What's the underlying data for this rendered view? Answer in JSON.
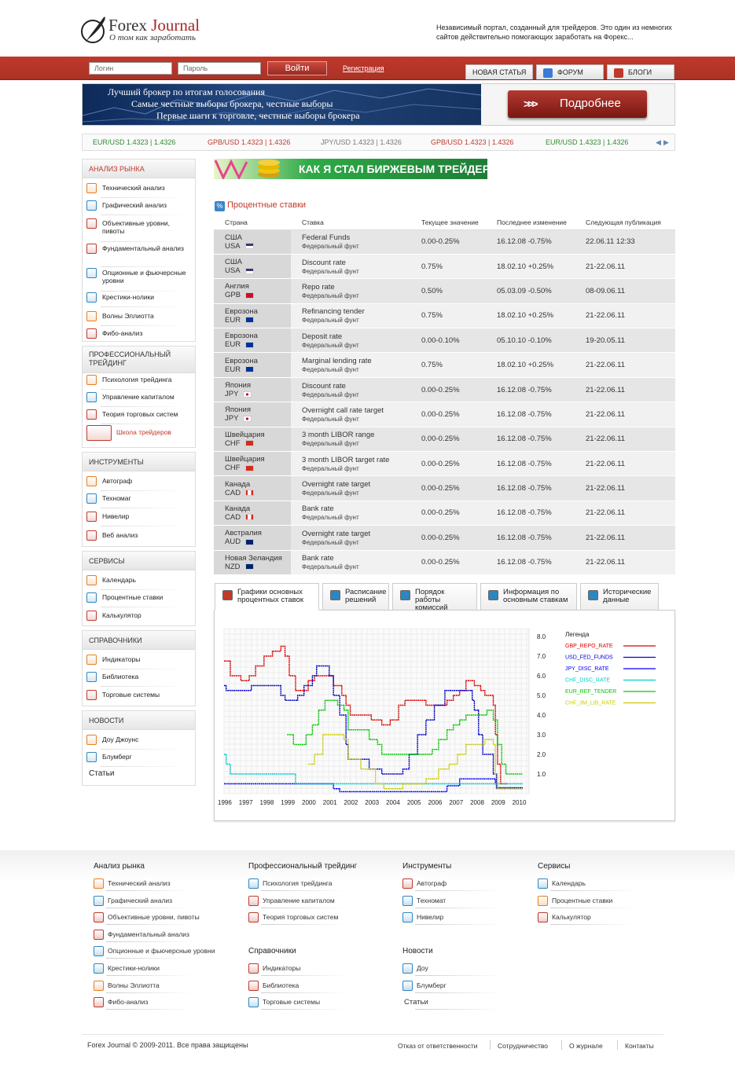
{
  "header": {
    "logo_word1": "Forex",
    "logo_word2": "Journal",
    "logo_sub": "О том как заработать",
    "tagline": "Независимый портал, созданный для трейдеров. Это один из немногих сайтов действительно помогающих заработать на Форекс..."
  },
  "topbar": {
    "login_placeholder": "Логин",
    "password_placeholder": "Пароль",
    "login_button": "Войти",
    "register": "Регистрация",
    "tabs": [
      "НОВАЯ СТАТЬЯ",
      "ФОРУМ",
      "БЛОГИ"
    ]
  },
  "banner": {
    "line1": "Лучший брокер по итогам голосования",
    "line2": "Самые честные выборы брокера, честные выборы",
    "line3": "Первые шаги к торговле, честные выборы брокера",
    "button": "Подробнее",
    "arrows": ">>>"
  },
  "ticker": [
    {
      "pair": "EUR/USD",
      "value": "1.4323 | 1.4326",
      "color": "#2e8b2e"
    },
    {
      "pair": "GPB/USD",
      "value": "1.4323 | 1.4326",
      "color": "#c0392b"
    },
    {
      "pair": "JPY/USD",
      "value": "1.4323 | 1.4326",
      "color": "#777777"
    },
    {
      "pair": "GPB/USD",
      "value": "1.4323 | 1.4326",
      "color": "#c0392b"
    },
    {
      "pair": "EUR/USD",
      "value": "1.4323 | 1.4326",
      "color": "#2e8b2e"
    }
  ],
  "sidebar": {
    "market": {
      "title": "АНАЛИЗ РЫНКА",
      "items": [
        "Технический анализ",
        "Графический анализ",
        "Объективные уровни, пивоты",
        "Фундаментальный анализ",
        "Опционные и фьючерсные уровни",
        "Крестики-нолики",
        "Волны Эллиотта",
        "Фибо-анализ"
      ]
    },
    "pro": {
      "title": "ПРОФЕССИОНАЛЬНЫЙ ТРЕЙДИНГ",
      "items": [
        "Психология трейдинга",
        "Управление капиталом",
        "Теория торговых систем",
        "Школа трейдеров"
      ]
    },
    "tools": {
      "title": "ИНСТРУМЕНТЫ",
      "items": [
        "Автограф",
        "Техномаг",
        "Нивелир",
        "Веб анализ"
      ]
    },
    "services": {
      "title": "СЕРВИСЫ",
      "items": [
        "Календарь",
        "Процентные ставки",
        "Калькулятор"
      ]
    },
    "refs": {
      "title": "СПРАВОЧНИКИ",
      "items": [
        "Индикаторы",
        "Библиотека",
        "Торговые системы"
      ]
    },
    "news": {
      "title": "НОВОСТИ",
      "items": [
        "Доу Джоунс",
        "Блумберг",
        "Статьи"
      ]
    }
  },
  "promo": "КАК Я СТАЛ БИРЖЕВЫМ ТРЕЙДЕРОМ",
  "rates": {
    "title": "Процентные ставки",
    "icon": "%",
    "headers": [
      "Страна",
      "Ставка",
      "Текущее значение",
      "Последнее изменение",
      "Следующая публикация"
    ],
    "rows": [
      {
        "country": "США",
        "code": "USA",
        "rate": "Federal Funds",
        "sub": "Федеральный фунт",
        "current": "0.00-0.25%",
        "last": "16.12.08 -0.75%",
        "next": "22.06.11   12:33"
      },
      {
        "country": "США",
        "code": "USA",
        "rate": "Discount rate",
        "sub": "Федеральный фунт",
        "current": "0.75%",
        "last": "18.02.10 +0.25%",
        "next": "21-22.06.11"
      },
      {
        "country": "Англия",
        "code": "GPB",
        "rate": "Repo rate",
        "sub": "Федеральный фунт",
        "current": "0.50%",
        "last": "05.03.09 -0.50%",
        "next": "08-09.06.11"
      },
      {
        "country": "Еврозона",
        "code": "EUR",
        "rate": "Refinancing tender",
        "sub": "Федеральный фунт",
        "current": "0.75%",
        "last": "18.02.10 +0.25%",
        "next": "21-22.06.11"
      },
      {
        "country": "Еврозона",
        "code": "EUR",
        "rate": "Deposit rate",
        "sub": "Федеральный фунт",
        "current": "0.00-0.10%",
        "last": "05.10.10 -0.10%",
        "next": "19-20.05.11"
      },
      {
        "country": "Еврозона",
        "code": "EUR",
        "rate": "Marginal lending rate",
        "sub": "Федеральный фунт",
        "current": "0.75%",
        "last": "18.02.10 +0.25%",
        "next": "21-22.06.11"
      },
      {
        "country": "Япония",
        "code": "JPY",
        "rate": "Discount rate",
        "sub": "Федеральный фунт",
        "current": "0.00-0.25%",
        "last": "16.12.08 -0.75%",
        "next": "21-22.06.11"
      },
      {
        "country": "Япония",
        "code": "JPY",
        "rate": "Overnight call rate target",
        "sub": "Федеральный фунт",
        "current": "0.00-0.25%",
        "last": "16.12.08 -0.75%",
        "next": "21-22.06.11"
      },
      {
        "country": "Швейцария",
        "code": "CHF",
        "rate": "3 month LIBOR range",
        "sub": "Федеральный фунт",
        "current": "0.00-0.25%",
        "last": "16.12.08 -0.75%",
        "next": "21-22.06.11"
      },
      {
        "country": "Швейцария",
        "code": "CHF",
        "rate": "3 month LIBOR target rate",
        "sub": "Федеральный фунт",
        "current": "0.00-0.25%",
        "last": "16.12.08 -0.75%",
        "next": "21-22.06.11"
      },
      {
        "country": "Канада",
        "code": "CAD",
        "rate": "Overnight rate target",
        "sub": "Федеральный фунт",
        "current": "0.00-0.25%",
        "last": "16.12.08 -0.75%",
        "next": "21-22.06.11"
      },
      {
        "country": "Канада",
        "code": "CAD",
        "rate": "Bank rate",
        "sub": "Федеральный фунт",
        "current": "0.00-0.25%",
        "last": "16.12.08 -0.75%",
        "next": "21-22.06.11"
      },
      {
        "country": "Австралия",
        "code": "AUD",
        "rate": "Overnight rate target",
        "sub": "Федеральный фунт",
        "current": "0.00-0.25%",
        "last": "16.12.08 -0.75%",
        "next": "21-22.06.11"
      },
      {
        "country": "Новая Зеландия",
        "code": "NZD",
        "rate": "Bank rate",
        "sub": "Федеральный фунт",
        "current": "0.00-0.25%",
        "last": "16.12.08 -0.75%",
        "next": "21-22.06.11"
      }
    ]
  },
  "chart_tabs": [
    "Графики основных процентных ставок",
    "Расписание решений",
    "Порядок работы комиссий",
    "Информация по основным ставкам",
    "Исторические данные"
  ],
  "chart_data": {
    "type": "line",
    "legend_title": "Легенда",
    "legend": "top-right",
    "grid": true,
    "x_ticks": [
      "1996",
      "1997",
      "1998",
      "1999",
      "2000",
      "2001",
      "2002",
      "2003",
      "2004",
      "2005",
      "2006",
      "2007",
      "2008",
      "2009",
      "2010"
    ],
    "y_ticks": [
      "8.0",
      "7.0",
      "6.0",
      "5.0",
      "4.0",
      "3.0",
      "2.0",
      "1.0"
    ],
    "xlim": [
      1996,
      2010.5
    ],
    "ylim": [
      0,
      8
    ],
    "series": [
      {
        "name": "GBP_REPO_RATE",
        "color": "#dd0000",
        "points": [
          [
            1996,
            6.75
          ],
          [
            1996.3,
            6.0
          ],
          [
            1996.8,
            5.75
          ],
          [
            1997.2,
            6.0
          ],
          [
            1997.5,
            6.5
          ],
          [
            1997.9,
            7.0
          ],
          [
            1998.3,
            7.25
          ],
          [
            1998.7,
            7.5
          ],
          [
            1998.9,
            7.0
          ],
          [
            1999.1,
            6.0
          ],
          [
            1999.4,
            5.25
          ],
          [
            1999.7,
            5.25
          ],
          [
            2000,
            5.75
          ],
          [
            2000.3,
            6.0
          ],
          [
            2000.8,
            6.0
          ],
          [
            2001.2,
            5.5
          ],
          [
            2001.6,
            5.0
          ],
          [
            2001.8,
            4.5
          ],
          [
            2002,
            4.0
          ],
          [
            2003,
            3.75
          ],
          [
            2003.5,
            3.5
          ],
          [
            2003.9,
            3.75
          ],
          [
            2004.3,
            4.5
          ],
          [
            2004.6,
            4.75
          ],
          [
            2005.6,
            4.5
          ],
          [
            2006.6,
            4.75
          ],
          [
            2006.9,
            5.0
          ],
          [
            2007.2,
            5.25
          ],
          [
            2007.5,
            5.75
          ],
          [
            2007.9,
            5.5
          ],
          [
            2008.2,
            5.25
          ],
          [
            2008.4,
            5.0
          ],
          [
            2008.8,
            4.5
          ],
          [
            2008.9,
            3.0
          ],
          [
            2009,
            1.5
          ],
          [
            2009.15,
            0.5
          ],
          [
            2009.5,
            0.5
          ]
        ]
      },
      {
        "name": "USD_FED_FUNDS",
        "color": "#0000cc",
        "points": [
          [
            1996,
            5.5
          ],
          [
            1996.1,
            5.25
          ],
          [
            1997.2,
            5.25
          ],
          [
            1997.3,
            5.5
          ],
          [
            1998.7,
            5.0
          ],
          [
            1998.9,
            4.75
          ],
          [
            1999.5,
            5.0
          ],
          [
            1999.8,
            5.5
          ],
          [
            2000.2,
            6.0
          ],
          [
            2000.4,
            6.5
          ],
          [
            2001,
            6.0
          ],
          [
            2001.2,
            5.0
          ],
          [
            2001.5,
            4.0
          ],
          [
            2001.8,
            2.5
          ],
          [
            2001.9,
            1.75
          ],
          [
            2002.9,
            1.25
          ],
          [
            2003.5,
            1.0
          ],
          [
            2004.5,
            1.25
          ],
          [
            2004.8,
            2.0
          ],
          [
            2005.2,
            3.0
          ],
          [
            2005.6,
            3.75
          ],
          [
            2006,
            4.5
          ],
          [
            2006.5,
            5.25
          ],
          [
            2007.6,
            5.25
          ],
          [
            2007.8,
            4.75
          ],
          [
            2007.9,
            4.25
          ],
          [
            2008.1,
            3.0
          ],
          [
            2008.3,
            2.0
          ],
          [
            2008.8,
            1.0
          ],
          [
            2008.95,
            0.25
          ],
          [
            2010.2,
            0.25
          ]
        ]
      },
      {
        "name": "JPY_DISC_RATE",
        "color": "#0000ff",
        "points": [
          [
            1996,
            0.5
          ],
          [
            2001,
            0.5
          ],
          [
            2001.2,
            0.25
          ],
          [
            2001.5,
            0.1
          ],
          [
            2006.5,
            0.1
          ],
          [
            2006.6,
            0.4
          ],
          [
            2007.2,
            0.75
          ],
          [
            2008.8,
            0.75
          ],
          [
            2008.9,
            0.5
          ],
          [
            2009,
            0.3
          ],
          [
            2010.2,
            0.3
          ]
        ]
      },
      {
        "name": "CHF_DISC_RATE",
        "color": "#00cccc",
        "points": [
          [
            1996,
            2.0
          ],
          [
            1996.1,
            1.5
          ],
          [
            1996.3,
            1.0
          ],
          [
            1999.3,
            1.0
          ],
          [
            1999.4,
            0.5
          ],
          [
            2000.2,
            0.5
          ],
          [
            2010.2,
            0.5
          ]
        ]
      },
      {
        "name": "EUR_REF_TENDER",
        "color": "#00cc00",
        "points": [
          [
            1999,
            3.0
          ],
          [
            1999.3,
            2.5
          ],
          [
            1999.9,
            3.0
          ],
          [
            2000.2,
            3.5
          ],
          [
            2000.5,
            4.25
          ],
          [
            2000.8,
            4.75
          ],
          [
            2001.4,
            4.5
          ],
          [
            2001.7,
            4.25
          ],
          [
            2001.9,
            3.25
          ],
          [
            2002.9,
            2.75
          ],
          [
            2003.3,
            2.5
          ],
          [
            2003.5,
            2.0
          ],
          [
            2005.9,
            2.25
          ],
          [
            2006.2,
            2.75
          ],
          [
            2006.6,
            3.25
          ],
          [
            2006.9,
            3.5
          ],
          [
            2007.2,
            3.75
          ],
          [
            2007.5,
            4.0
          ],
          [
            2008.5,
            4.25
          ],
          [
            2008.8,
            3.75
          ],
          [
            2009,
            2.5
          ],
          [
            2009.2,
            1.5
          ],
          [
            2009.4,
            1.0
          ],
          [
            2010.2,
            1.0
          ]
        ]
      },
      {
        "name": "CHF_3M_LIB_RATE",
        "color": "#cccc00",
        "points": [
          [
            2000,
            1.5
          ],
          [
            2000.3,
            2.0
          ],
          [
            2000.7,
            3.0
          ],
          [
            2001.3,
            3.0
          ],
          [
            2001.7,
            2.75
          ],
          [
            2001.9,
            1.75
          ],
          [
            2002.5,
            1.25
          ],
          [
            2003.2,
            0.5
          ],
          [
            2003.6,
            0.25
          ],
          [
            2004.5,
            0.5
          ],
          [
            2005.6,
            0.75
          ],
          [
            2006.2,
            1.25
          ],
          [
            2006.7,
            1.5
          ],
          [
            2007.1,
            2.0
          ],
          [
            2007.5,
            2.5
          ],
          [
            2008.4,
            2.75
          ],
          [
            2008.8,
            2.5
          ],
          [
            2008.9,
            1.0
          ],
          [
            2009,
            0.25
          ],
          [
            2010.2,
            0.25
          ]
        ]
      }
    ]
  },
  "footer": {
    "cols": [
      {
        "title": "Анализ рынка",
        "items": [
          "Технический анализ",
          "Графический анализ",
          "Объективные уровни, пивоты",
          "Фундаментальный анализ",
          "Опционные и фьючерсные уровни",
          "Крестики-нолики",
          "Волны Эллиотта",
          "Фибо-анализ"
        ]
      },
      {
        "title": "Профессиональный трейдинг",
        "items": [
          "Психология трейдинга",
          "Управление капиталом",
          "Теория торговых систем"
        ]
      },
      {
        "title": "Справочники",
        "items": [
          "Индикаторы",
          "Библиотека",
          "Торговые системы"
        ]
      },
      {
        "title": "Инструменты",
        "items": [
          "Автограф",
          "Техномат",
          "Нивелир"
        ]
      },
      {
        "title": "Новости",
        "items": [
          "Доу",
          "Блумберг",
          "Статьи"
        ]
      },
      {
        "title": "Сервисы",
        "items": [
          "Календарь",
          "Процентные ставки",
          "Калькулятор"
        ]
      }
    ],
    "copyright": "Forex Journal © 2009-2011. Все права защищены",
    "links": [
      "Отказ от ответственности",
      "Сотрудничество",
      "О журнале",
      "Контакты"
    ]
  }
}
